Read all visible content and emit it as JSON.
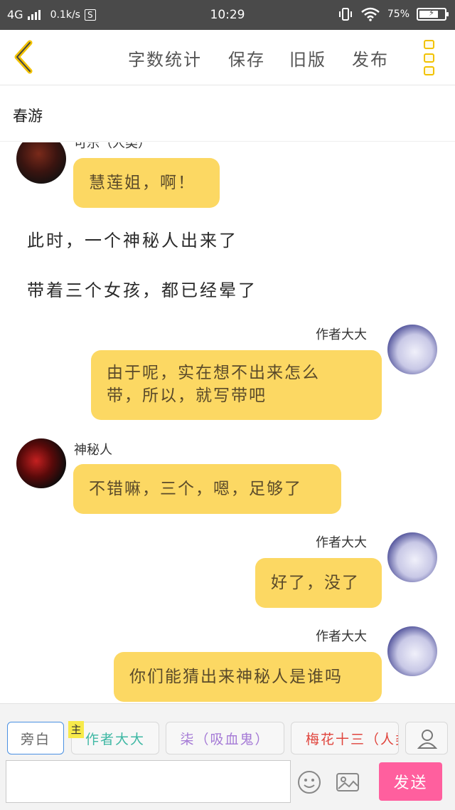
{
  "status_bar": {
    "network": "4G",
    "speed": "0.1k/s",
    "s_badge": "S",
    "time": "10:29",
    "battery_percent": "75%",
    "battery_level": 0.75
  },
  "toolbar": {
    "word_count": "字数统计",
    "save": "保存",
    "old_version": "旧版",
    "publish": "发布"
  },
  "story": {
    "title": "春游"
  },
  "chat": {
    "messages": [
      {
        "sender": "可乐（人类）",
        "text": "慧莲姐，啊！"
      },
      {
        "narration": "此时，一个神秘人出来了"
      },
      {
        "narration": "带着三个女孩，都已经晕了"
      },
      {
        "sender": "作者大大",
        "lines": [
          "由于呢，实在想不出来怎么",
          "带，所以，就写带吧"
        ]
      },
      {
        "sender": "神秘人",
        "text": "不错嘛，三个，嗯，足够了"
      },
      {
        "sender": "作者大大",
        "text": "好了，没了"
      },
      {
        "sender": "作者大大",
        "text": "你们能猜出来神秘人是谁吗"
      }
    ]
  },
  "roles": {
    "narration_label": "旁白",
    "main_tag": "主",
    "items": [
      {
        "label": "作者大大",
        "color": "#3fb8a4"
      },
      {
        "label": "柒（吸血鬼）",
        "color": "#a57ad6"
      },
      {
        "label": "梅花十三（人类）",
        "color": "#e0443c"
      }
    ]
  },
  "composer": {
    "input_value": "",
    "send_label": "发送"
  },
  "colors": {
    "bubble": "#fcd863",
    "accent": "#f2c200",
    "send": "#ff5f9e"
  }
}
